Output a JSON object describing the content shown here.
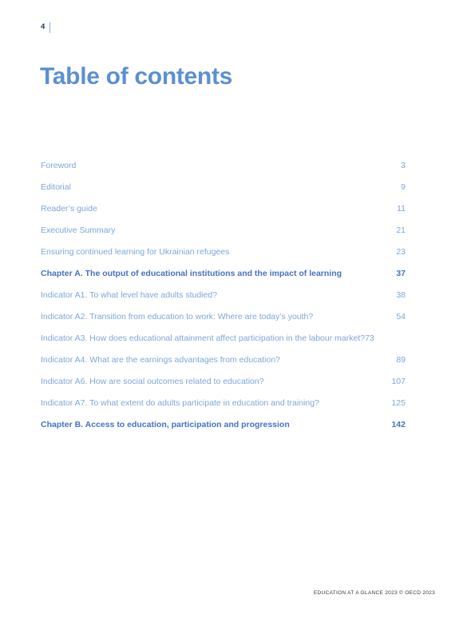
{
  "header": {
    "folio": "4"
  },
  "title": "Table of contents",
  "toc": {
    "entries": [
      {
        "label": "Foreword",
        "page": "3",
        "level": "section",
        "flush": false
      },
      {
        "label": "Editorial",
        "page": "9",
        "level": "section",
        "flush": false
      },
      {
        "label": "Reader’s guide",
        "page": "11",
        "level": "section",
        "flush": false
      },
      {
        "label": "Executive Summary",
        "page": "21",
        "level": "section",
        "flush": false
      },
      {
        "label": "Ensuring continued learning for Ukrainian refugees",
        "page": "23",
        "level": "section",
        "flush": false
      },
      {
        "label": "Chapter A. The output of educational institutions and the impact of learning",
        "page": "37",
        "level": "chapter",
        "flush": false
      },
      {
        "label": "Indicator A1. To what level have adults studied?",
        "page": "38",
        "level": "section",
        "flush": false
      },
      {
        "label": "Indicator A2. Transition from education to work: Where are today’s youth?",
        "page": "54",
        "level": "section",
        "flush": false
      },
      {
        "label": "Indicator A3. How does educational attainment affect participation in the labour market?",
        "page": "73",
        "level": "section",
        "flush": true
      },
      {
        "label": "Indicator A4. What are the earnings advantages from education?",
        "page": "89",
        "level": "section",
        "flush": false
      },
      {
        "label": "Indicator A6. How are social outcomes related to education?",
        "page": "107",
        "level": "section",
        "flush": false
      },
      {
        "label": "Indicator A7. To what extent do adults participate in education and training?",
        "page": "125",
        "level": "section",
        "flush": false
      },
      {
        "label": "Chapter B. Access to education, participation and progression",
        "page": "142",
        "level": "chapter",
        "flush": false
      }
    ]
  },
  "footer": {
    "text": "EDUCATION AT A GLANCE 2023 © OECD 2023"
  },
  "colors": {
    "title_blue": "#5b8fd4",
    "entry_blue": "#7ba7dd",
    "chapter_blue": "#4472c4",
    "folio_navy": "#1f3864",
    "footer_gray": "#3b3b3b"
  }
}
